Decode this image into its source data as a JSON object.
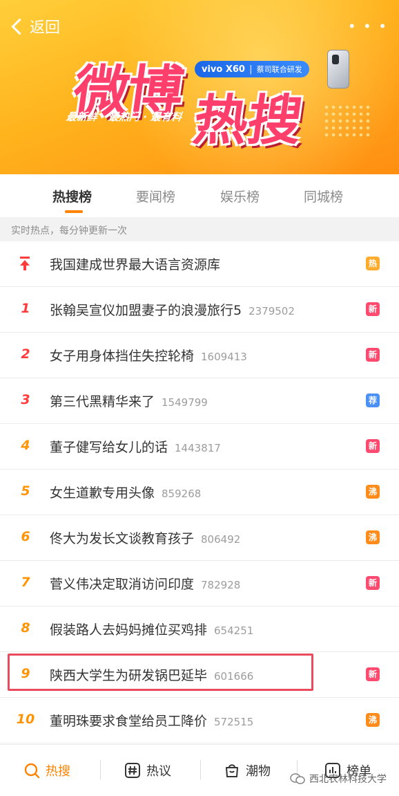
{
  "header": {
    "back_label": "返回",
    "more_label": "• • •",
    "logo_part1": "微博",
    "logo_part2": "热搜",
    "slogan": "最新鲜 · 最热门 · 最有料",
    "sponsor_brand": "vivo X60",
    "sponsor_sub": "蔡司联合研发"
  },
  "tabs": [
    {
      "label": "热搜榜",
      "active": true
    },
    {
      "label": "要闻榜",
      "active": false
    },
    {
      "label": "娱乐榜",
      "active": false
    },
    {
      "label": "同城榜",
      "active": false
    }
  ],
  "subheader": "实时热点，每分钟更新一次",
  "items": [
    {
      "rank": "",
      "pinned": true,
      "title": "我国建成世界最大语言资源库",
      "count": "",
      "badge": "热",
      "badge_type": "hot"
    },
    {
      "rank": "1",
      "title": "张翰吴宣仪加盟妻子的浪漫旅行5",
      "count": "2379502",
      "badge": "新",
      "badge_type": "new"
    },
    {
      "rank": "2",
      "title": "女子用身体挡住失控轮椅",
      "count": "1609413",
      "badge": "新",
      "badge_type": "new"
    },
    {
      "rank": "3",
      "title": "第三代黑精华来了",
      "count": "1549799",
      "badge": "荐",
      "badge_type": "rec"
    },
    {
      "rank": "4",
      "title": "董子健写给女儿的话",
      "count": "1443817",
      "badge": "新",
      "badge_type": "new"
    },
    {
      "rank": "5",
      "title": "女生道歉专用头像",
      "count": "859268",
      "badge": "沸",
      "badge_type": "boil"
    },
    {
      "rank": "6",
      "title": "佟大为发长文谈教育孩子",
      "count": "806492",
      "badge": "沸",
      "badge_type": "boil"
    },
    {
      "rank": "7",
      "title": "菅义伟决定取消访问印度",
      "count": "782928",
      "badge": "新",
      "badge_type": "new"
    },
    {
      "rank": "8",
      "title": "假装路人去妈妈摊位买鸡排",
      "count": "654251",
      "badge": "",
      "badge_type": ""
    },
    {
      "rank": "9",
      "title": "陕西大学生为研发锅巴延毕",
      "count": "601666",
      "badge": "新",
      "badge_type": "new"
    },
    {
      "rank": "10",
      "title": "董明珠要求食堂给员工降价",
      "count": "572515",
      "badge": "沸",
      "badge_type": "boil"
    }
  ],
  "bottom_nav": [
    {
      "label": "热搜",
      "icon": "search-icon",
      "active": true
    },
    {
      "label": "热议",
      "icon": "hashtag-icon",
      "active": false
    },
    {
      "label": "潮物",
      "icon": "bag-icon",
      "active": false
    },
    {
      "label": "榜单",
      "icon": "chart-icon",
      "active": false
    }
  ],
  "watermark": "西北农林科技大学",
  "colors": {
    "accent": "#ff8200",
    "hot_badge": "#ffab2d",
    "new_badge": "#ff4a6f",
    "rec_badge": "#4a90f5",
    "boil_badge": "#ff8c1a",
    "highlight": "#ea4a5d"
  }
}
